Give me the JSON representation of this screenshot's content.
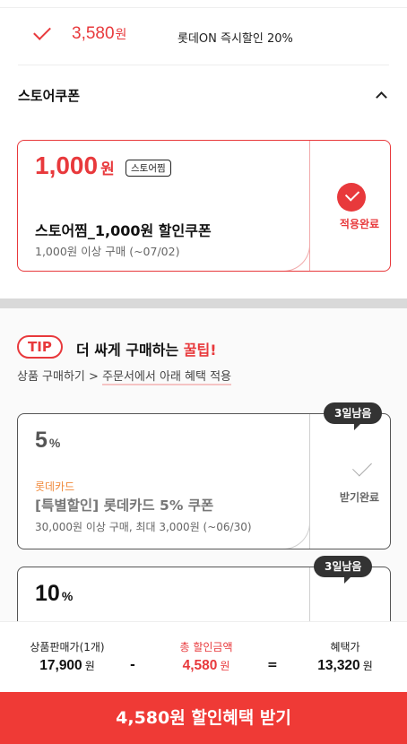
{
  "top_discount": {
    "amount": "3,580",
    "unit": "원",
    "description": "롯데ON 즉시할인 20%"
  },
  "store_coupon": {
    "title": "스토어쿠폰",
    "coupon": {
      "amount": "1,000",
      "unit": "원",
      "tag": "스토어찜",
      "name": "스토어찜_1,000원 할인쿠폰",
      "condition": "1,000원 이상 구매  (~07/02)",
      "status": "적용완료"
    }
  },
  "tip": {
    "badge": "TIP",
    "title_prefix": "더 싸게 구매하는 ",
    "title_highlight": "꿀팁!",
    "sub_prefix": "상품 구매하기 > ",
    "sub_underlined": "주문서에서 아래 혜택 적용"
  },
  "card_coupons": [
    {
      "days_left": "3일남음",
      "rate": "5",
      "pct": "%",
      "brand": "롯데카드",
      "name": "[특별할인] 롯데카드 5% 쿠폰",
      "condition": "30,000원 이상 구매, 최대 3,000원 (~06/30)",
      "status": "받기완료"
    },
    {
      "days_left": "3일남음",
      "rate": "10",
      "pct": "%"
    }
  ],
  "summary": {
    "price_label": "상품판매가(1개)",
    "price_value": "17,900",
    "discount_label": "총 할인금액",
    "discount_value": "4,580",
    "final_label": "혜택가",
    "final_value": "13,320",
    "unit": "원",
    "minus": "-",
    "equals": "="
  },
  "cta_label": "4,580원 할인혜택 받기",
  "colors": {
    "accent": "#e8393c",
    "cta": "#ef3a36",
    "brand_orange": "#f08a3c"
  }
}
